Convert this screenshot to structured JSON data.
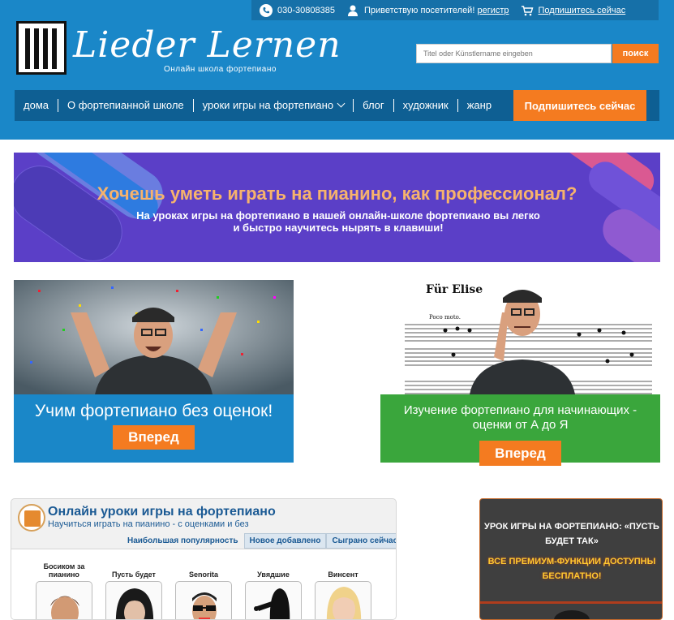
{
  "topbar": {
    "phone": "030-30808385",
    "greeting": "Приветствую посетителей!",
    "register_link": "регистр",
    "subscribe_link": "Подпишитесь сейчас"
  },
  "logo": {
    "title": "Lieder Lernen",
    "subtitle": "Онлайн школа фортепиано"
  },
  "search": {
    "placeholder": "Titel oder Künstlername eingeben",
    "button": "поиск"
  },
  "nav": {
    "items": [
      "дома",
      "О фортепианной школе",
      "уроки игры на фортепиано",
      "блог",
      "художник",
      "жанр"
    ],
    "subscribe": "Подпишитесь сейчас"
  },
  "banner": {
    "headline": "Хочешь уметь играть на пианино, как профессионал?",
    "text": "На уроках игры на фортепиано в нашей онлайн-школе фортепиано вы легко и быстро научитесь нырять в клавиши!"
  },
  "cards": [
    {
      "title": "Учим фортепиано без оценок!",
      "button": "Вперед"
    },
    {
      "title": "Изучение фортепиано для начинающих - оценки от А до Я",
      "button": "Вперед",
      "sheet_title": "Für Elise",
      "sheet_tempo": "Poco moto."
    }
  ],
  "widget": {
    "title": "Онлайн уроки игры на фортепиано",
    "subtitle": "Научиться играть на пианино - с оценками и без",
    "tabs": [
      "Наибольшая популярность",
      "Новое добавлено",
      "Сыграно сейчас"
    ],
    "artists": [
      "Босиком за пианино",
      "Пусть будет",
      "Senorita",
      "Увядшие",
      "Винсент"
    ]
  },
  "sidead": {
    "title": "УРОК ИГРЫ НА ФОРТЕПИАНО: «ПУСТЬ БУДЕТ ТАК»",
    "feature": "ВСЕ ПРЕМИУМ-ФУНКЦИИ ДОСТУПНЫ БЕСПЛАТНО!"
  },
  "colors": {
    "header_blue": "#1a87c8",
    "nav_dark_blue": "#0e5f93",
    "accent_orange": "#f47b20",
    "banner_purple": "#5b3fc7",
    "card_green": "#3aa63c"
  }
}
